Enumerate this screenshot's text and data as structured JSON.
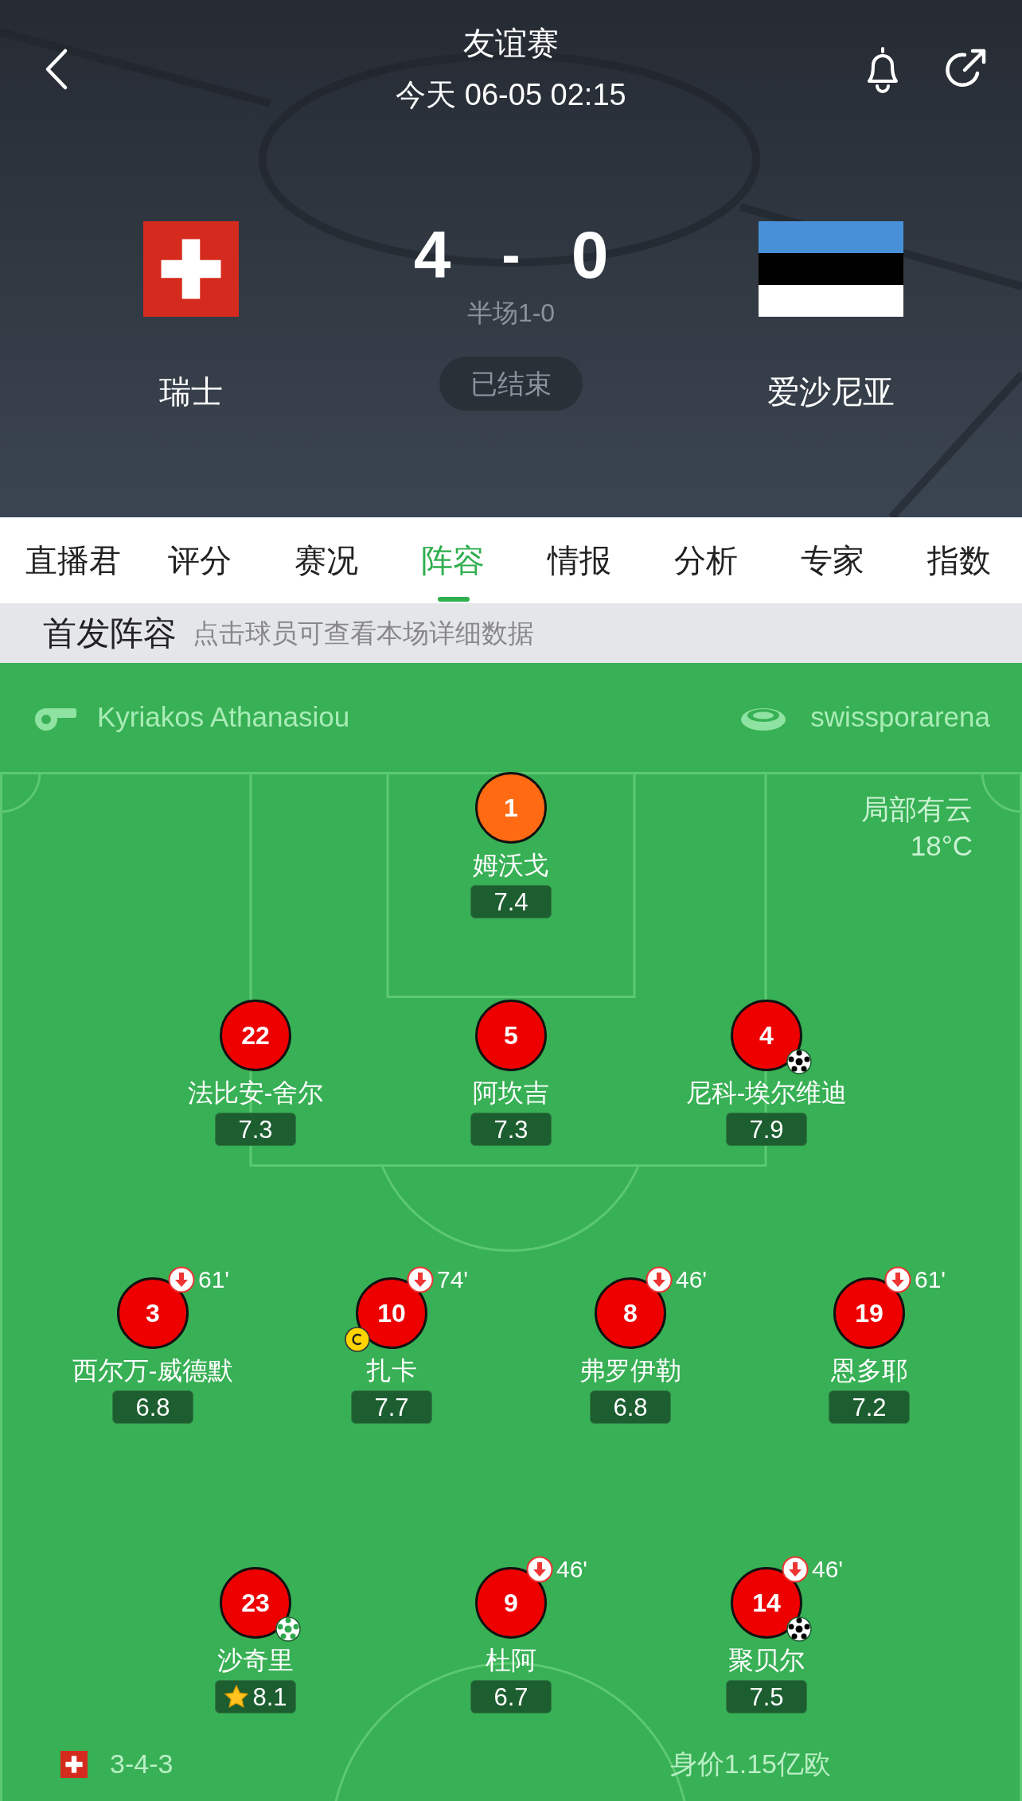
{
  "header": {
    "competition": "友谊赛",
    "datetime": "今天 06-05 02:15",
    "home": {
      "name": "瑞士"
    },
    "away": {
      "name": "爱沙尼亚"
    },
    "score_home": "4",
    "score_separator": "-",
    "score_away": "0",
    "halftime": "半场1-0",
    "status": "已结束"
  },
  "tabs": [
    {
      "label": "直播君",
      "selected": false
    },
    {
      "label": "评分",
      "selected": false
    },
    {
      "label": "赛况",
      "selected": false
    },
    {
      "label": "阵容",
      "selected": true
    },
    {
      "label": "情报",
      "selected": false
    },
    {
      "label": "分析",
      "selected": false
    },
    {
      "label": "专家",
      "selected": false
    },
    {
      "label": "指数",
      "selected": false
    }
  ],
  "section": {
    "title": "首发阵容",
    "hint": "点击球员可查看本场详细数据"
  },
  "lineup": {
    "referee": "Kyriakos Athanasiou",
    "venue": "swissporarena",
    "weather": "局部有云",
    "temperature": "18°C",
    "formation": "3-4-3",
    "market_value": "身价1.15亿欧",
    "lines": [
      {
        "players": [
          {
            "number": "1",
            "name": "姆沃戈",
            "rating": "7.4",
            "color": "#ff6a13",
            "captain": false,
            "best": false,
            "goal": false,
            "assist": false
          }
        ]
      },
      {
        "players": [
          {
            "number": "22",
            "name": "法比安-舍尔",
            "rating": "7.3",
            "color": "#ee0000",
            "captain": false,
            "best": false,
            "goal": false,
            "assist": false
          },
          {
            "number": "5",
            "name": "阿坎吉",
            "rating": "7.3",
            "color": "#ee0000",
            "captain": false,
            "best": false,
            "goal": false,
            "assist": false
          },
          {
            "number": "4",
            "name": "尼科-埃尔维迪",
            "rating": "7.9",
            "color": "#ee0000",
            "captain": false,
            "best": false,
            "goal": true,
            "assist": false
          }
        ]
      },
      {
        "players": [
          {
            "number": "3",
            "name": "西尔万-威德默",
            "rating": "6.8",
            "color": "#ee0000",
            "captain": false,
            "best": false,
            "goal": false,
            "assist": false,
            "sub_minute": "61'"
          },
          {
            "number": "10",
            "name": "扎卡",
            "rating": "7.7",
            "color": "#ee0000",
            "captain": true,
            "best": false,
            "goal": false,
            "assist": false,
            "sub_minute": "74'"
          },
          {
            "number": "8",
            "name": "弗罗伊勒",
            "rating": "6.8",
            "color": "#ee0000",
            "captain": false,
            "best": false,
            "goal": false,
            "assist": false,
            "sub_minute": "46'"
          },
          {
            "number": "19",
            "name": "恩多耶",
            "rating": "7.2",
            "color": "#ee0000",
            "captain": false,
            "best": false,
            "goal": false,
            "assist": false,
            "sub_minute": "61'"
          }
        ]
      },
      {
        "players": [
          {
            "number": "23",
            "name": "沙奇里",
            "rating": "8.1",
            "color": "#ee0000",
            "captain": false,
            "best": true,
            "goal": false,
            "assist": true
          },
          {
            "number": "9",
            "name": "杜阿",
            "rating": "6.7",
            "color": "#ee0000",
            "captain": false,
            "best": false,
            "goal": false,
            "assist": false,
            "sub_minute": "46'"
          },
          {
            "number": "14",
            "name": "聚贝尔",
            "rating": "7.5",
            "color": "#ee0000",
            "captain": false,
            "best": false,
            "goal": true,
            "assist": false,
            "sub_minute": "46'"
          }
        ]
      }
    ]
  }
}
